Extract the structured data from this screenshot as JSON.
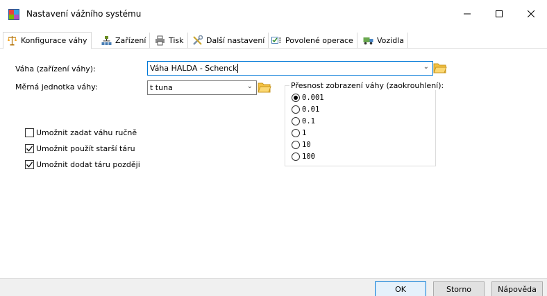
{
  "window": {
    "title": "Nastavení vážního systému"
  },
  "tabs": [
    {
      "label": "Konfigurace váhy",
      "icon": "scale-icon"
    },
    {
      "label": "Zařízení",
      "icon": "network-icon"
    },
    {
      "label": "Tisk",
      "icon": "printer-icon"
    },
    {
      "label": "Další nastavení",
      "icon": "tools-icon"
    },
    {
      "label": "Povolené operace",
      "icon": "checklist-icon"
    },
    {
      "label": "Vozidla",
      "icon": "truck-icon"
    }
  ],
  "form": {
    "scale_label": "Váha (zařízení váhy):",
    "scale_value": "Váha HALDA - Schenck",
    "unit_label": "Měrná jednotka váhy:",
    "unit_value": "t tuna"
  },
  "precision": {
    "title": "Přesnost zobrazení váhy (zaokrouhlení):",
    "options": [
      "0.001",
      "0.01",
      "0.1",
      "1",
      "10",
      "100"
    ],
    "selected": "0.001"
  },
  "checkboxes": [
    {
      "label": "Umožnit zadat váhu ručně",
      "checked": false
    },
    {
      "label": "Umožnit použít starší táru",
      "checked": true
    },
    {
      "label": "Umožnit dodat táru později",
      "checked": true
    }
  ],
  "buttons": {
    "ok": "OK",
    "cancel": "Storno",
    "help": "Nápověda"
  },
  "colors": {
    "focus_border": "#0078d7",
    "folder": "#f5c242"
  }
}
